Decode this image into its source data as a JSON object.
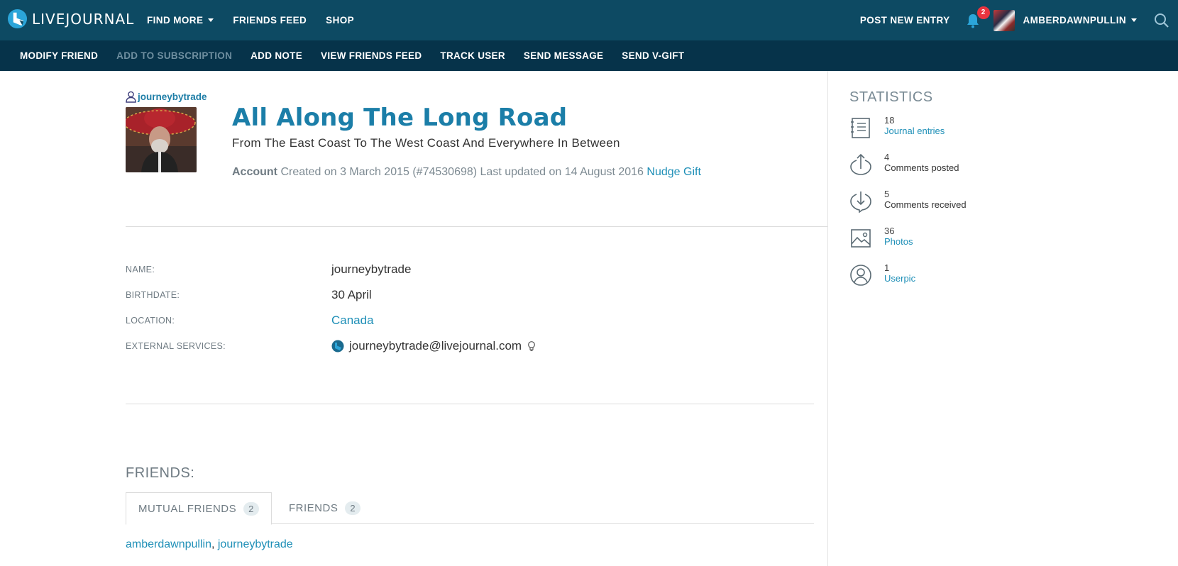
{
  "header": {
    "logo_text": "LIVEJOURNAL",
    "nav": [
      "FIND MORE",
      "FRIENDS FEED",
      "SHOP"
    ],
    "post_entry": "POST NEW ENTRY",
    "notification_count": "2",
    "username": "AMBERDAWNPULLIN",
    "brand_color": "#0d4a63"
  },
  "subnav": {
    "items": [
      "MODIFY FRIEND",
      "ADD TO SUBSCRIPTION",
      "ADD NOTE",
      "VIEW FRIENDS FEED",
      "TRACK USER",
      "SEND MESSAGE",
      "SEND V-GIFT"
    ]
  },
  "profile": {
    "user_link": "journeybytrade",
    "journal_title": "All Along The Long Road",
    "journal_subtitle": "From The East Coast To The West Coast And Everywhere In Between",
    "account_label": "Account",
    "account_info": "Created on 3 March 2015 (#74530698) Last updated on 14 August 2016",
    "nudge_link": "Nudge Gift",
    "title_color": "#1b7ea8"
  },
  "details": {
    "name_label": "NAME:",
    "name_value": "journeybytrade",
    "birthdate_label": "BIRTHDATE:",
    "birthdate_value": "30 April",
    "location_label": "LOCATION:",
    "location_value": "Canada",
    "external_label": "EXTERNAL SERVICES:",
    "external_value": "journeybytrade@livejournal.com"
  },
  "friends": {
    "title": "FRIENDS:",
    "tabs": [
      {
        "label": "MUTUAL FRIENDS",
        "count": "2"
      },
      {
        "label": "FRIENDS",
        "count": "2"
      }
    ],
    "list": [
      "amberdawnpullin",
      "journeybytrade"
    ],
    "separator": ", "
  },
  "statistics": {
    "title": "STATISTICS",
    "items": [
      {
        "value": "18",
        "label": "Journal entries",
        "icon": "journal-icon"
      },
      {
        "value": "4",
        "label": "Comments posted",
        "icon": "comment-out-icon"
      },
      {
        "value": "5",
        "label": "Comments received",
        "icon": "comment-in-icon"
      },
      {
        "value": "36",
        "label": "Photos",
        "icon": "photo-icon"
      },
      {
        "value": "1",
        "label": "Userpic",
        "icon": "userpic-icon"
      }
    ]
  }
}
